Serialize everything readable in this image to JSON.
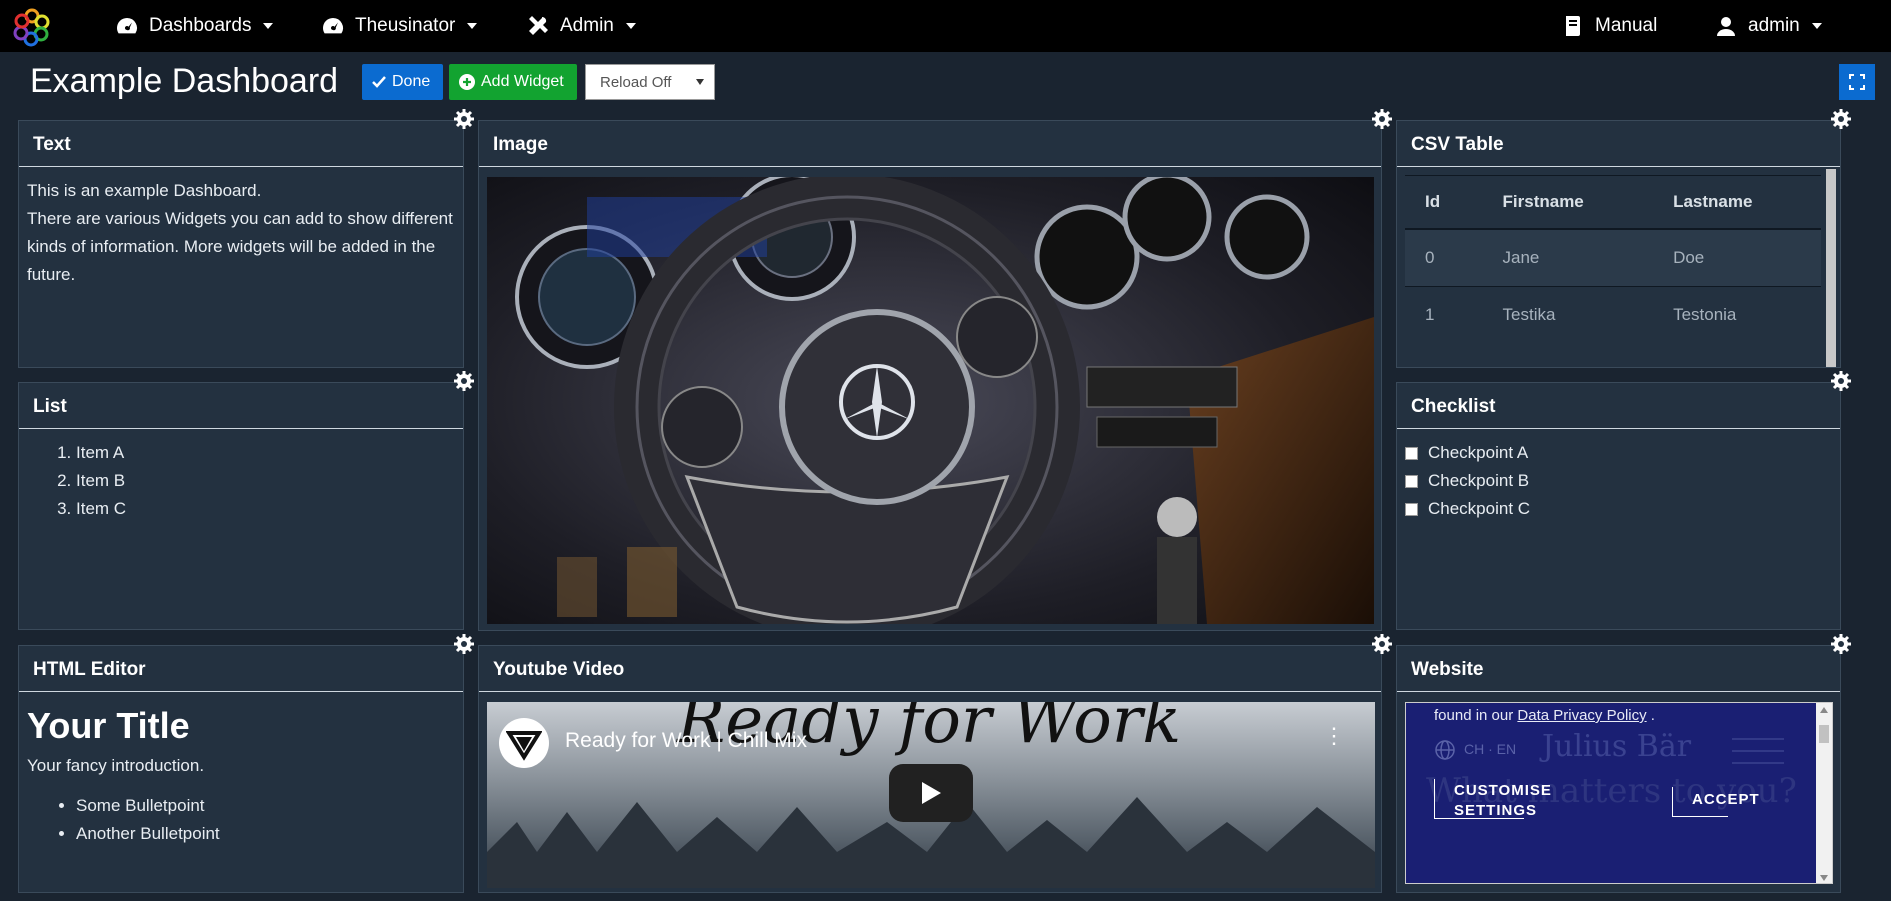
{
  "nav": {
    "dashboards": "Dashboards",
    "theusinator": "Theusinator",
    "admin": "Admin",
    "manual": "Manual",
    "user": "admin"
  },
  "page": {
    "title": "Example Dashboard",
    "done_label": "Done",
    "add_widget_label": "Add Widget",
    "reload_value": "Reload Off"
  },
  "widgets": {
    "text": {
      "title": "Text",
      "line1": "This is an example Dashboard.",
      "line2": "There are various Widgets you can add to show different kinds of information. More widgets will be added in the future."
    },
    "image": {
      "title": "Image"
    },
    "csv": {
      "title": "CSV Table",
      "headers": [
        "Id",
        "Firstname",
        "Lastname"
      ],
      "rows": [
        [
          "0",
          "Jane",
          "Doe"
        ],
        [
          "1",
          "Testika",
          "Testonia"
        ]
      ]
    },
    "list": {
      "title": "List",
      "items": [
        "Item A",
        "Item B",
        "Item C"
      ]
    },
    "checklist": {
      "title": "Checklist",
      "items": [
        "Checkpoint A",
        "Checkpoint B",
        "Checkpoint C"
      ]
    },
    "html": {
      "title": "HTML Editor",
      "heading": "Your Title",
      "intro": "Your fancy introduction.",
      "bullets": [
        "Some Bulletpoint",
        "Another Bulletpoint"
      ]
    },
    "youtube": {
      "title": "Youtube Video",
      "video_title": "Ready for Work | Chill Mix",
      "overlay_text": "Ready for Work"
    },
    "website": {
      "title": "Website",
      "privacy_prefix": "found in our",
      "privacy_link": "Data Privacy Policy",
      "privacy_suffix": ".",
      "lang": "CH · EN",
      "brand": "Julius Bär",
      "headline": "What matters to you?",
      "customise": "CUSTOMISE SETTINGS",
      "accept": "ACCEPT"
    }
  },
  "colors": {
    "primary": "#0b6bd0",
    "success": "#12a330",
    "panel": "#233140",
    "background": "#1a2430"
  }
}
